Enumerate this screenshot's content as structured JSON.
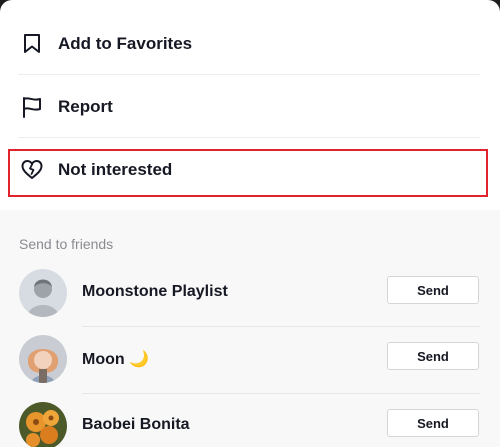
{
  "menu": {
    "items": [
      {
        "label": "Add to Favorites",
        "icon": "bookmark-icon"
      },
      {
        "label": "Report",
        "icon": "flag-icon"
      },
      {
        "label": "Not interested",
        "icon": "broken-heart-icon"
      }
    ]
  },
  "friends": {
    "title": "Send to friends",
    "send_label": "Send",
    "list": [
      {
        "name": "Moonstone Playlist"
      },
      {
        "name": "Moon 🌙"
      },
      {
        "name": "Baobei Bonita"
      }
    ]
  },
  "colors": {
    "highlight": "#e0242a",
    "text": "#161823",
    "muted": "#8a8b91"
  }
}
